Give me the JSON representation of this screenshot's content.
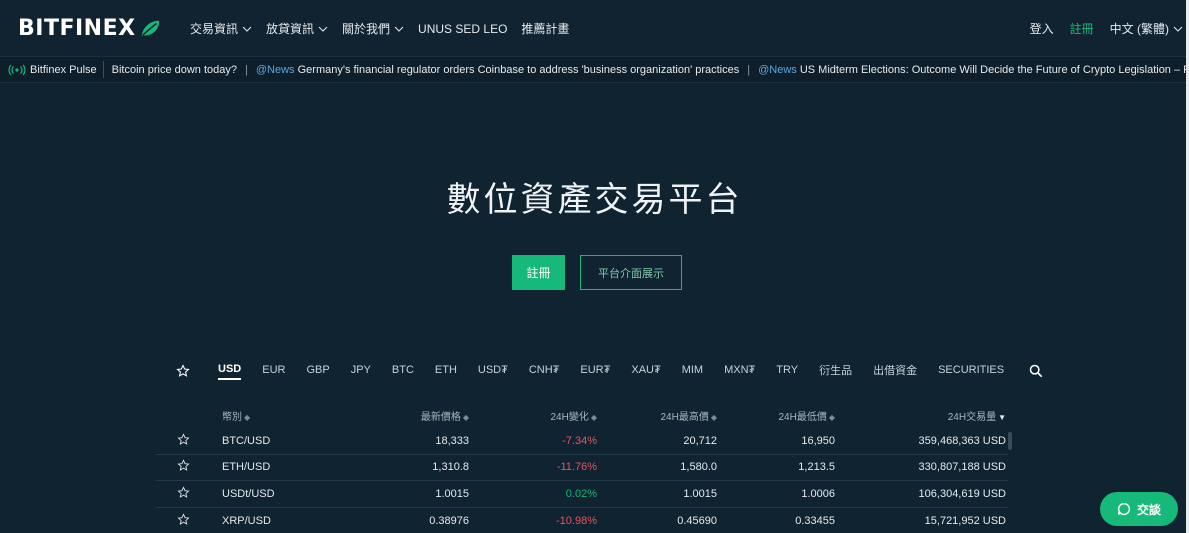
{
  "header": {
    "logo_text": "BITFINEX",
    "nav": [
      {
        "label": "交易資訊"
      },
      {
        "label": "放貸資訊"
      },
      {
        "label": "關於我們"
      },
      {
        "label": "UNUS SED LEO"
      },
      {
        "label": "推薦計畫"
      }
    ],
    "login": "登入",
    "register": "註冊",
    "language": "中文 (繁體)"
  },
  "ticker": {
    "pulse_label": "Bitfinex Pulse",
    "items": [
      {
        "source": "",
        "text": "Bitcoin price down today?"
      },
      {
        "source": "@News",
        "text": " Germany's financial regulator orders Coinbase to address 'business organization' practices"
      },
      {
        "source": "@News",
        "text": " US Midterm Elections: Outcome Will Decide the Future of Crypto Legislation – Republican"
      }
    ],
    "separator": "|"
  },
  "hero": {
    "title": "數位資產交易平台",
    "register_label": "註冊",
    "demo_label": "平台介面展示"
  },
  "market": {
    "tabs": [
      "USD",
      "EUR",
      "GBP",
      "JPY",
      "BTC",
      "ETH",
      "USD₮",
      "CNH₮",
      "EUR₮",
      "XAU₮",
      "MIM",
      "MXN₮",
      "TRY",
      "衍生品",
      "出借資金",
      "SECURITIES"
    ],
    "active_tab": "USD",
    "columns": {
      "pair": "幣別",
      "last": "最新價格",
      "change": "24H變化",
      "high": "24H最高價",
      "low": "24H最低價",
      "volume": "24H交易量"
    },
    "rows": [
      {
        "pair": "BTC/USD",
        "last": "18,333",
        "change": "-7.34%",
        "dir": "neg",
        "high": "20,712",
        "low": "16,950",
        "volume": "359,468,363 USD"
      },
      {
        "pair": "ETH/USD",
        "last": "1,310.8",
        "change": "-11.76%",
        "dir": "neg",
        "high": "1,580.0",
        "low": "1,213.5",
        "volume": "330,807,188 USD"
      },
      {
        "pair": "USDt/USD",
        "last": "1.0015",
        "change": "0.02%",
        "dir": "pos",
        "high": "1.0015",
        "low": "1.0006",
        "volume": "106,304,619 USD"
      },
      {
        "pair": "XRP/USD",
        "last": "0.38976",
        "change": "-10.98%",
        "dir": "neg",
        "high": "0.45690",
        "low": "0.33455",
        "volume": "15,721,952 USD"
      }
    ]
  },
  "chat": {
    "label": "交談"
  },
  "colors": {
    "accent": "#16b979",
    "negative": "#e55561",
    "background": "#0f2330"
  }
}
